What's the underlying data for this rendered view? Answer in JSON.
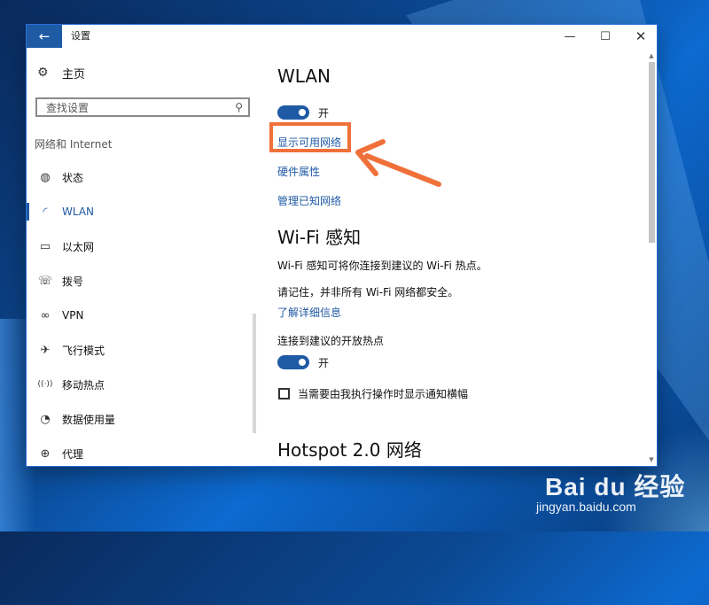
{
  "window": {
    "title": "设置",
    "back_icon": "←",
    "minimize_icon": "—",
    "maximize_icon": "☐",
    "close_icon": "✕"
  },
  "sidebar": {
    "home": {
      "icon": "⚙",
      "label": "主页"
    },
    "search": {
      "placeholder": "查找设置",
      "icon": "⚲"
    },
    "section_label": "网络和 Internet",
    "items": [
      {
        "icon": "◍",
        "label": "状态",
        "active": false
      },
      {
        "icon": "◜",
        "label": "WLAN",
        "active": true
      },
      {
        "icon": "▭",
        "label": "以太网",
        "active": false
      },
      {
        "icon": "☏",
        "label": "拨号",
        "active": false
      },
      {
        "icon": "∞",
        "label": "VPN",
        "active": false
      },
      {
        "icon": "✈",
        "label": "飞行模式",
        "active": false
      },
      {
        "icon": "((·))",
        "label": "移动热点",
        "active": false
      },
      {
        "icon": "◔",
        "label": "数据使用量",
        "active": false
      },
      {
        "icon": "⊕",
        "label": "代理",
        "active": false
      }
    ]
  },
  "main": {
    "wlan_heading": "WLAN",
    "wlan_toggle_label": "开",
    "show_networks_link": "显示可用网络",
    "hardware_link": "硬件属性",
    "manage_known_link": "管理已知网络",
    "wifi_sense_heading": "Wi-Fi 感知",
    "wifi_sense_desc": "Wi-Fi 感知可将你连接到建议的 Wi-Fi 热点。",
    "wifi_sense_note": "请记住，并非所有 Wi-Fi 网络都安全。",
    "learn_more_link": "了解详细信息",
    "open_hotspot_label": "连接到建议的开放热点",
    "open_hotspot_toggle_label": "开",
    "notify_checkbox_label": "当需要由我执行操作时显示通知横幅",
    "hotspot_heading": "Hotspot 2.0 网络"
  },
  "watermark": {
    "logo": "Bai du 经验",
    "url": "jingyan.baidu.com"
  },
  "colors": {
    "accent": "#1f5aa5",
    "highlight": "#f0703a"
  }
}
